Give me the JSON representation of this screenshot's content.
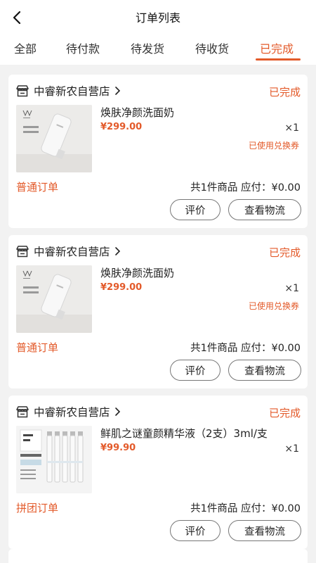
{
  "header": {
    "title": "订单列表",
    "back_icon": "chevron-left-icon"
  },
  "tabs": [
    {
      "label": "全部",
      "active": false
    },
    {
      "label": "待付款",
      "active": false
    },
    {
      "label": "待发货",
      "active": false
    },
    {
      "label": "待收货",
      "active": false
    },
    {
      "label": "已完成",
      "active": true
    }
  ],
  "colors": {
    "accent": "#e35a2a",
    "background": "#f2f2f2",
    "card": "#ffffff"
  },
  "orders": [
    {
      "shop_name": "中睿新农自营店",
      "status": "已完成",
      "product_name": "焕肤净颜洗面奶",
      "price": "¥299.00",
      "quantity": "×1",
      "coupon_note": "已使用兑换券",
      "order_type": "普通订单",
      "summary": "共1件商品 应付：¥0.00",
      "buttons": {
        "review": "评价",
        "logistics": "查看物流"
      },
      "thumb_kind": "tube"
    },
    {
      "shop_name": "中睿新农自营店",
      "status": "已完成",
      "product_name": "焕肤净颜洗面奶",
      "price": "¥299.00",
      "quantity": "×1",
      "coupon_note": "已使用兑换券",
      "order_type": "普通订单",
      "summary": "共1件商品 应付：¥0.00",
      "buttons": {
        "review": "评价",
        "logistics": "查看物流"
      },
      "thumb_kind": "tube"
    },
    {
      "shop_name": "中睿新农自营店",
      "status": "已完成",
      "product_name": "鲜肌之谜童颜精华液（2支）3ml/支",
      "price": "¥99.90",
      "quantity": "×1",
      "coupon_note": "",
      "order_type": "拼团订单",
      "summary": "共1件商品 应付：¥0.00",
      "buttons": {
        "review": "评价",
        "logistics": "查看物流"
      },
      "thumb_kind": "vials"
    }
  ]
}
